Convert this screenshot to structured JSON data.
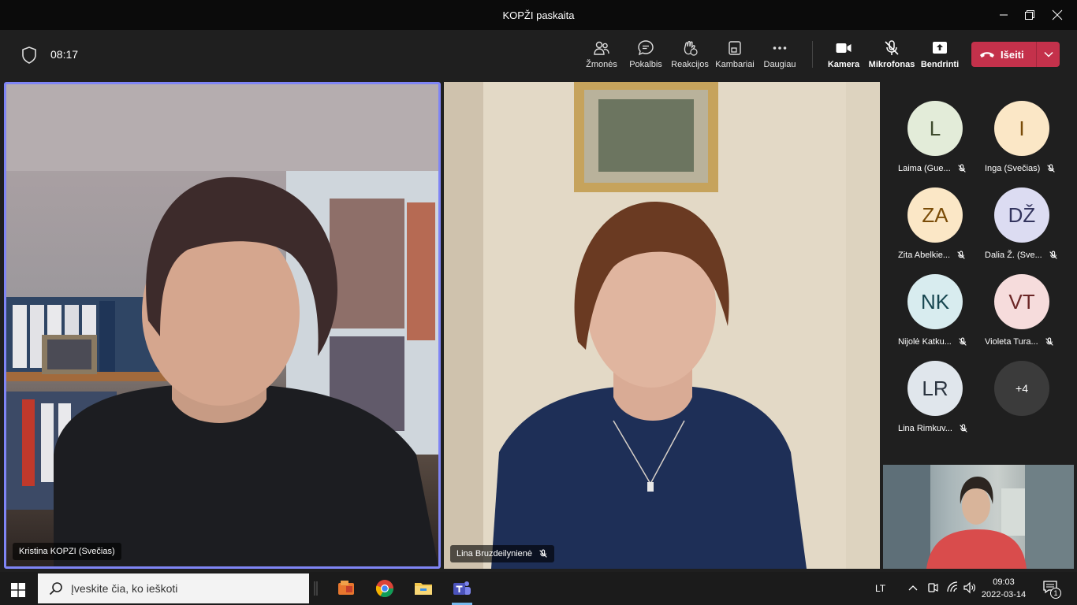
{
  "window": {
    "title": "KOPŽI paskaita"
  },
  "toolbar": {
    "timer": "08:17",
    "buttons": [
      {
        "label": "Žmonės",
        "icon": "people-icon"
      },
      {
        "label": "Pokalbis",
        "icon": "chat-icon"
      },
      {
        "label": "Reakcijos",
        "icon": "reactions-icon"
      },
      {
        "label": "Kambariai",
        "icon": "rooms-icon"
      },
      {
        "label": "Daugiau",
        "icon": "more-icon"
      },
      {
        "label": "Kamera",
        "icon": "camera-icon"
      },
      {
        "label": "Mikrofonas",
        "icon": "mic-off-icon"
      },
      {
        "label": "Bendrinti",
        "icon": "share-icon"
      }
    ],
    "leave_label": "Išeiti"
  },
  "videos": [
    {
      "name": "Kristina KOPZI (Svečias)"
    },
    {
      "name": "Lina Bruzdeilynienė"
    }
  ],
  "participants": [
    {
      "initials": "L",
      "name": "Laima (Gue...",
      "bg": "#e3ecd9",
      "fg": "#3d4a2c"
    },
    {
      "initials": "I",
      "name": "Inga (Svečias)",
      "bg": "#fbe7c6",
      "fg": "#7a4c08"
    },
    {
      "initials": "ZA",
      "name": "Zita Abelkie...",
      "bg": "#fbe7c6",
      "fg": "#7a4c08"
    },
    {
      "initials": "DŽ",
      "name": "Dalia Ž. (Sve...",
      "bg": "#dcdcf2",
      "fg": "#33345e"
    },
    {
      "initials": "NK",
      "name": "Nijolė Katku...",
      "bg": "#d8ecef",
      "fg": "#174650"
    },
    {
      "initials": "VT",
      "name": "Violeta Tura...",
      "bg": "#f6dcdc",
      "fg": "#6b2626"
    },
    {
      "initials": "LR",
      "name": "Lina Rimkuv...",
      "bg": "#e0e6ec",
      "fg": "#2b3440"
    },
    {
      "initials": "+4",
      "name": "",
      "bg": "#3b3b3b",
      "fg": "#ffffff"
    }
  ],
  "taskbar": {
    "search_placeholder": "Įveskite čia, ko ieškoti",
    "language": "LT",
    "time": "09:03",
    "date": "2022-03-14",
    "notification_count": "1"
  },
  "colors": {
    "accent": "#7f85f5",
    "leave": "#c4314b"
  }
}
